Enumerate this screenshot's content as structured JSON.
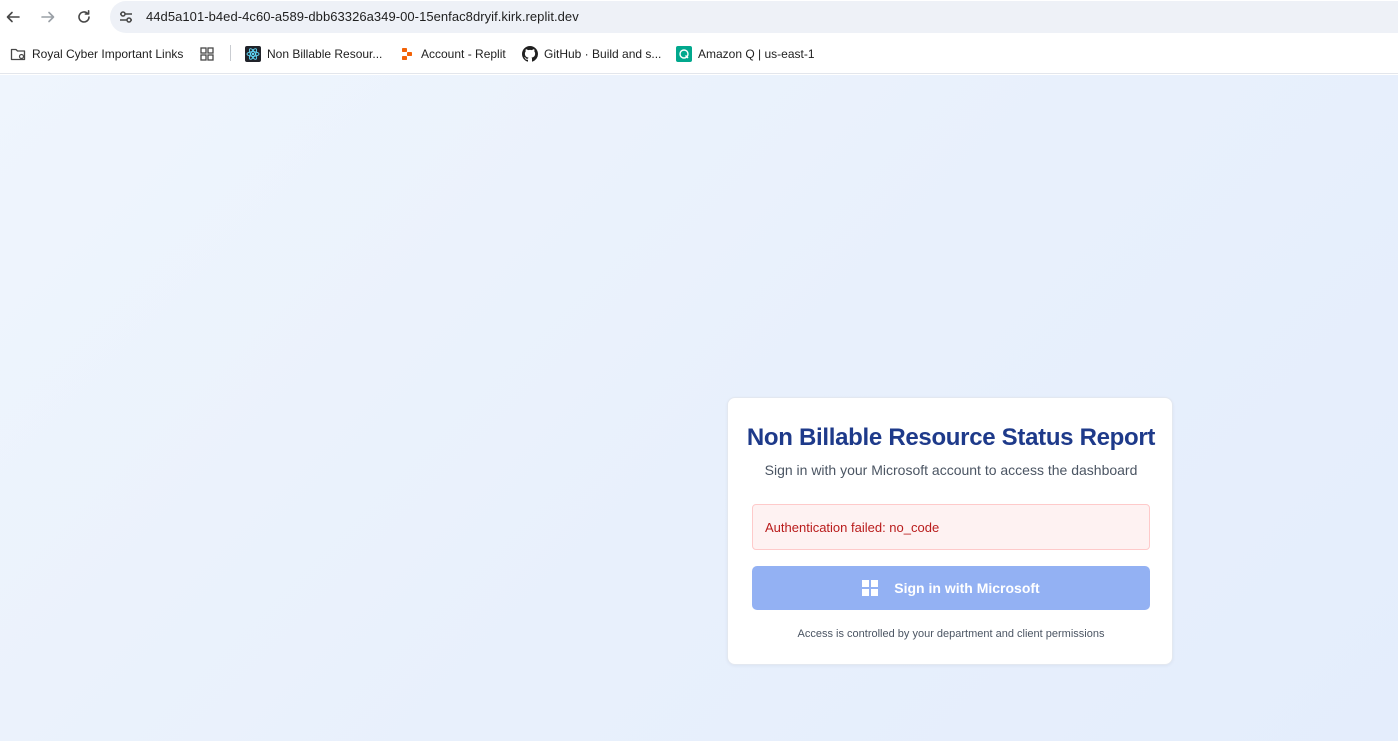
{
  "browser": {
    "url": "44d5a101-b4ed-4c60-a589-dbb63326a349-00-15enfac8dryif.kirk.replit.dev",
    "icons": {
      "back": "back-arrow-icon",
      "forward": "forward-arrow-icon",
      "reload": "reload-icon",
      "site_info": "tune-icon"
    }
  },
  "bookmarks": [
    {
      "label": "Royal Cyber Important Links",
      "icon": "folder-settings-icon"
    },
    {
      "label": "",
      "icon": "apps-grid-icon"
    },
    {
      "label": "Non Billable Resour...",
      "icon": "react-atom-icon"
    },
    {
      "label": "Account - Replit",
      "icon": "replit-icon"
    },
    {
      "label": "GitHub · Build and s...",
      "icon": "github-icon"
    },
    {
      "label": "Amazon Q | us-east-1",
      "icon": "amazon-q-icon"
    }
  ],
  "login": {
    "title": "Non Billable Resource Status Report",
    "subtitle": "Sign in with your Microsoft account to access the dashboard",
    "error": "Authentication failed: no_code",
    "button_label": "Sign in with Microsoft",
    "footnote": "Access is controlled by your department and client permissions"
  },
  "colors": {
    "title": "#1e3a8a",
    "button_bg": "#93b1f3",
    "error_bg": "#fef2f2",
    "error_border": "#fecaca",
    "error_text": "#b91c1c",
    "page_bg": "#eaf1fc"
  }
}
